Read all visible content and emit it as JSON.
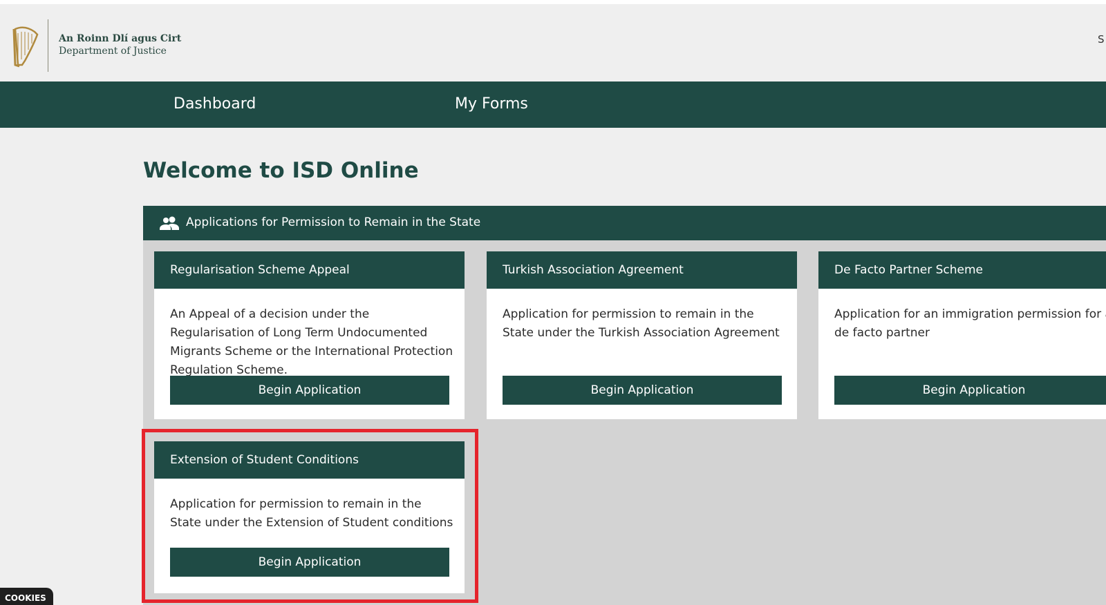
{
  "header": {
    "logo_irish": "An Roinn Dlí agus Cirt",
    "logo_english": "Department of Justice",
    "edge_text": "S",
    "logo_icon": "harp-icon"
  },
  "nav": {
    "items": [
      {
        "label": "Dashboard",
        "active": true
      },
      {
        "label": "My Forms",
        "active": false
      }
    ]
  },
  "main": {
    "title": "Welcome to ISD Online",
    "section": {
      "icon": "people-icon",
      "title": "Applications for Permission to Remain in the State",
      "cards": [
        {
          "title": "Regularisation Scheme Appeal",
          "description": "An Appeal of a decision under the Regularisation of Long Term Undocumented Migrants Scheme or the International Protection Regulation Scheme.",
          "button": "Begin Application"
        },
        {
          "title": "Turkish Association Agreement",
          "description": "Application for permission to remain in the State under the Turkish Association Agreement",
          "button": "Begin Application"
        },
        {
          "title": "De Facto Partner Scheme",
          "description": "Application for an immigration permission for a de facto partner",
          "button": "Begin Application"
        },
        {
          "title": "Extension of Student Conditions",
          "description": "Application for permission to remain in the State under the Extension of Student conditions",
          "button": "Begin Application"
        }
      ]
    }
  },
  "cookies": {
    "label": "COOKIES"
  },
  "colors": {
    "brand_green": "#1f4b45",
    "highlight_red": "#e5242c",
    "page_background": "#efefef",
    "section_background": "#d3d3d3"
  }
}
